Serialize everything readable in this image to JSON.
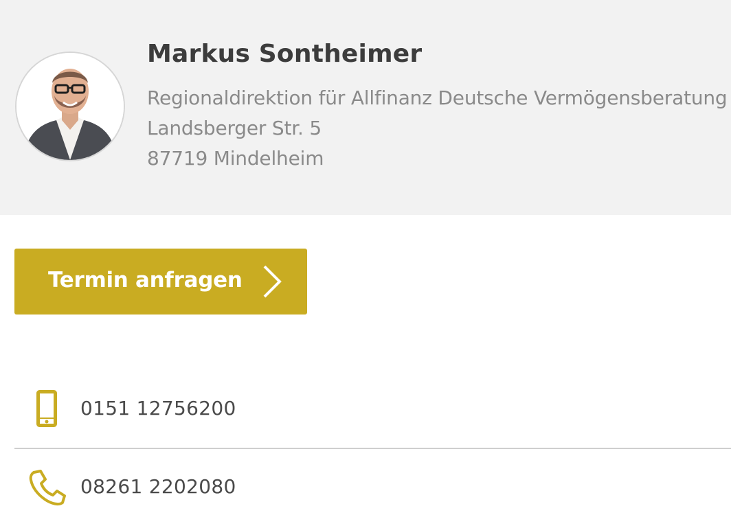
{
  "agent": {
    "name": "Markus Sontheimer",
    "office": "Regionaldirektion für Allfinanz Deutsche Vermögensberatung",
    "street": "Landsberger Str. 5",
    "city": "87719 Mindelheim",
    "avatar_icon": "person-photo"
  },
  "cta": {
    "label": "Termin anfragen",
    "icon": "chevron-right-icon"
  },
  "contacts": [
    {
      "icon": "mobile-phone-icon",
      "value": "0151 12756200"
    },
    {
      "icon": "phone-handset-icon",
      "value": "08261 2202080"
    }
  ],
  "colors": {
    "accent": "#c9ac22",
    "header_bg": "#f2f2f2",
    "name_text": "#3c3c3c",
    "address_text": "#8a8a8a",
    "contact_text": "#4a4a4a"
  }
}
